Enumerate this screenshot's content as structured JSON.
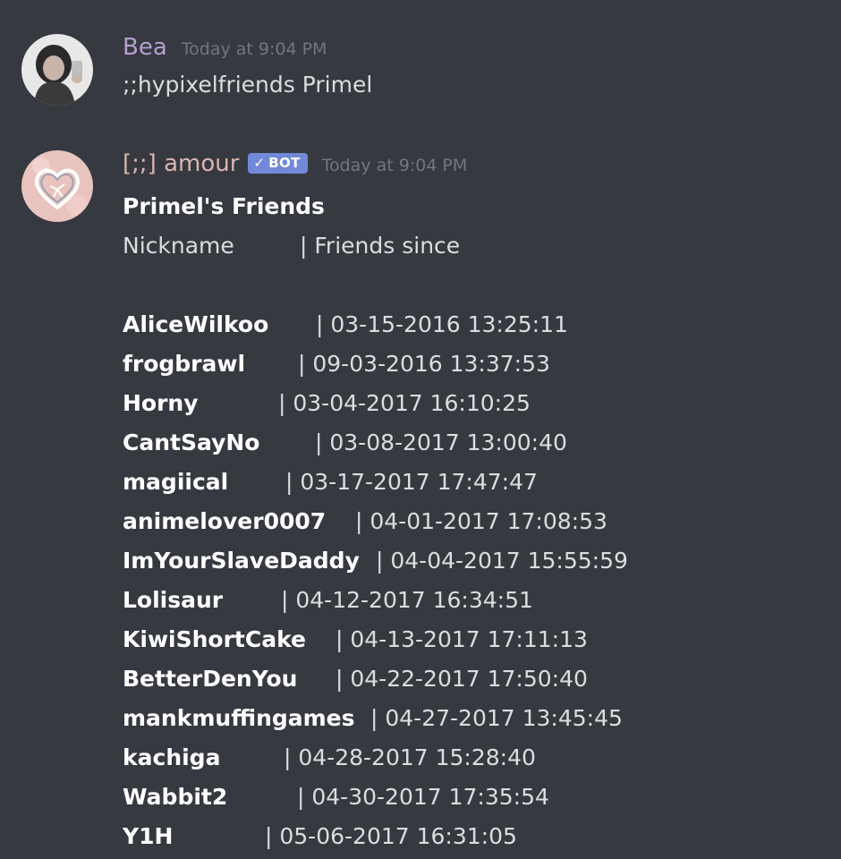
{
  "messages": [
    {
      "author": "Bea",
      "author_color": "#b69fcd",
      "timestamp": "Today at 9:04 PM",
      "text": ";;hypixelfriends Primel"
    },
    {
      "author": "[;;] amour",
      "author_color": "#d9b6b0",
      "bot_tag": "BOT",
      "bot_check_icon": "✓",
      "timestamp": "Today at 9:04 PM",
      "title": "Primel's Friends",
      "header_nick": "Nickname",
      "header_since": "| Friends since",
      "friends": [
        {
          "nick": "AliceWilkoo",
          "since": "| 03-15-2016 13:25:11"
        },
        {
          "nick": "frogbrawl",
          "since": "| 09-03-2016 13:37:53"
        },
        {
          "nick": "Horny",
          "since": "| 03-04-2017 16:10:25"
        },
        {
          "nick": "CantSayNo",
          "since": "| 03-08-2017 13:00:40"
        },
        {
          "nick": "magiical",
          "since": "| 03-17-2017 17:47:47"
        },
        {
          "nick": "animelover0007",
          "since": "| 04-01-2017 17:08:53"
        },
        {
          "nick": "ImYourSlaveDaddy",
          "since": "| 04-04-2017 15:55:59"
        },
        {
          "nick": "Lolisaur",
          "since": "| 04-12-2017 16:34:51"
        },
        {
          "nick": "KiwiShortCake",
          "since": "| 04-13-2017 17:11:13"
        },
        {
          "nick": "BetterDenYou",
          "since": "| 04-22-2017 17:50:40"
        },
        {
          "nick": "mankmuffingames",
          "since": "| 04-27-2017 13:45:45"
        },
        {
          "nick": "kachiga",
          "since": "| 04-28-2017 15:28:40"
        },
        {
          "nick": "Wabbit2",
          "since": "| 04-30-2017 17:35:54"
        },
        {
          "nick": "Y1H",
          "since": "| 05-06-2017 16:31:05"
        }
      ]
    }
  ],
  "colors": {
    "background": "#36393f",
    "text": "#dcddde",
    "timestamp": "#72767d",
    "bot_tag": "#7289da"
  },
  "icons": {
    "avatar_1": "user-photo-avatar",
    "avatar_2": "heart-ribbon-avatar",
    "bot_check": "check-icon"
  }
}
